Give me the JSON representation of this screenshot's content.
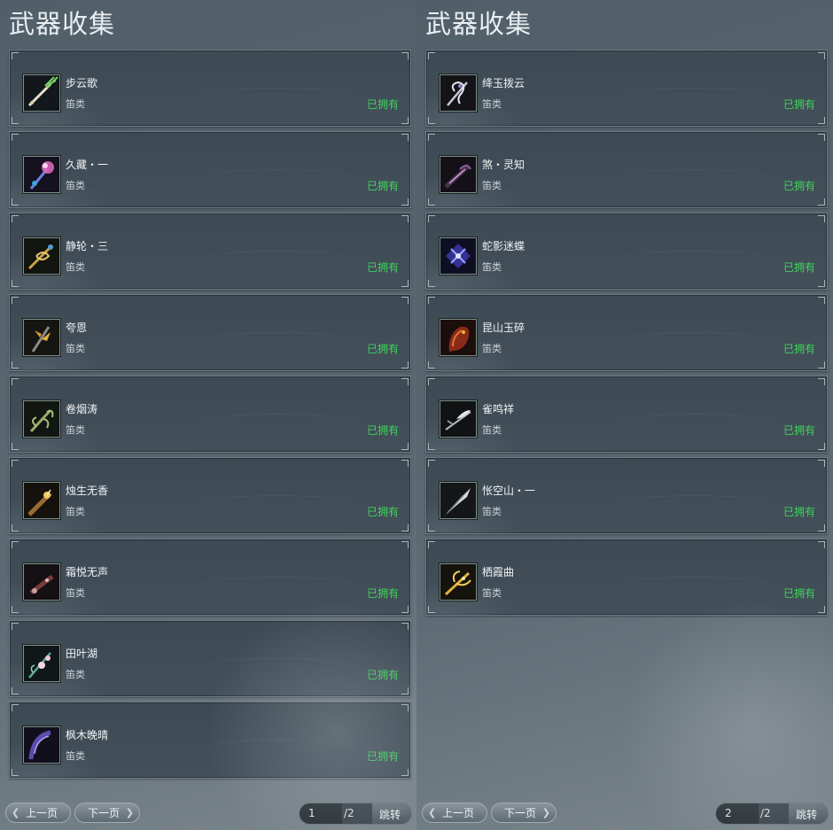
{
  "left": {
    "title": "武器收集",
    "items": [
      {
        "name": "步云歌",
        "category": "笛类",
        "status": "已拥有",
        "icon": "flute-green-leaf-icon"
      },
      {
        "name": "久藏・一",
        "category": "笛类",
        "status": "已拥有",
        "icon": "flute-pink-blossom-icon"
      },
      {
        "name": "静轮・三",
        "category": "笛类",
        "status": "已拥有",
        "icon": "flute-gold-dragon-icon"
      },
      {
        "name": "夸恩",
        "category": "笛类",
        "status": "已拥有",
        "icon": "flute-gold-claw-icon"
      },
      {
        "name": "卷烟涛",
        "category": "笛类",
        "status": "已拥有",
        "icon": "flute-green-vine-icon"
      },
      {
        "name": "烛生无香",
        "category": "笛类",
        "status": "已拥有",
        "icon": "flute-bronze-candle-icon"
      },
      {
        "name": "霜悦无声",
        "category": "笛类",
        "status": "已拥有",
        "icon": "flute-dark-red-icon"
      },
      {
        "name": "田叶湖",
        "category": "笛类",
        "status": "已拥有",
        "icon": "flute-teal-lotus-icon"
      },
      {
        "name": "枫木晚晴",
        "category": "笛类",
        "status": "已拥有",
        "icon": "flute-purple-crescent-icon"
      }
    ],
    "prev_label": "上一页",
    "next_label": "下一页",
    "page_value": "1",
    "page_total": "/2",
    "jump_label": "跳转"
  },
  "right": {
    "title": "武器收集",
    "items": [
      {
        "name": "绛玉拨云",
        "category": "笛类",
        "status": "已拥有",
        "icon": "flute-silver-spiral-icon"
      },
      {
        "name": "煞・灵知",
        "category": "笛类",
        "status": "已拥有",
        "icon": "flute-dark-purple-icon"
      },
      {
        "name": "蛇影迷蝶",
        "category": "笛类",
        "status": "已拥有",
        "icon": "flute-blue-butterfly-icon"
      },
      {
        "name": "昆山玉碎",
        "category": "笛类",
        "status": "已拥有",
        "icon": "flute-red-dragon-icon"
      },
      {
        "name": "雀鸣祥",
        "category": "笛类",
        "status": "已拥有",
        "icon": "flute-silver-bird-icon"
      },
      {
        "name": "怅空山・一",
        "category": "笛类",
        "status": "已拥有",
        "icon": "flute-silver-blade-icon"
      },
      {
        "name": "栖霞曲",
        "category": "笛类",
        "status": "已拥有",
        "icon": "flute-gold-phoenix-icon"
      }
    ],
    "prev_label": "上一页",
    "next_label": "下一页",
    "page_value": "2",
    "page_total": "/2",
    "jump_label": "跳转"
  },
  "colors": {
    "owned": "#3fd35a",
    "card_bg": "#404d56",
    "panel_bg": "#56646d"
  }
}
